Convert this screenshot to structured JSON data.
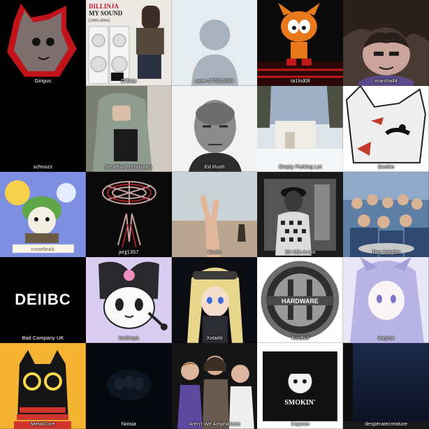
{
  "grid": {
    "tiles": [
      {
        "label": "Gingus"
      },
      {
        "label": "Dillinja"
      },
      {
        "label": "user-177606689"
      },
      {
        "label": "ta1lsd0ll"
      },
      {
        "label": "marshall4"
      },
      {
        "label": "schnozz"
      },
      {
        "label": "breathingtechniques"
      },
      {
        "label": "Ed Rush"
      },
      {
        "label": "Empty Parking Lot"
      },
      {
        "label": "Doshie"
      },
      {
        "label": "russelbuck"
      },
      {
        "label": "jorjj1357"
      },
      {
        "label": "kinola"
      },
      {
        "label": "Sir Mix-A-Lot"
      },
      {
        "label": "Two Knights"
      },
      {
        "label": "Bad Company UK"
      },
      {
        "label": "kur0mya"
      },
      {
        "label": "Xxtarlit"
      },
      {
        "label": "Konflict"
      },
      {
        "label": "lexycat"
      },
      {
        "label": "MetalCore"
      },
      {
        "label": "Noisia"
      },
      {
        "label": "Aren't We Amphibians"
      },
      {
        "label": "Capone"
      },
      {
        "label": "desperatecreature"
      }
    ]
  },
  "artwork_text": {
    "dillinja_title": "DILLINJA",
    "dillinja_subtitle": "MY SOUND",
    "dillinja_years": "[1993-2004]",
    "badcompany_logo": "DEIIBC",
    "hardware_logo": "HARDWARE",
    "smokin_logo": "SMOKIN'",
    "russelbuck_caption": "russelbuck"
  },
  "colors": {
    "background": "#000000",
    "label_text": "#ffffff",
    "placeholder_bg": "#e6ebef",
    "placeholder_figure": "#a8b2bd"
  }
}
